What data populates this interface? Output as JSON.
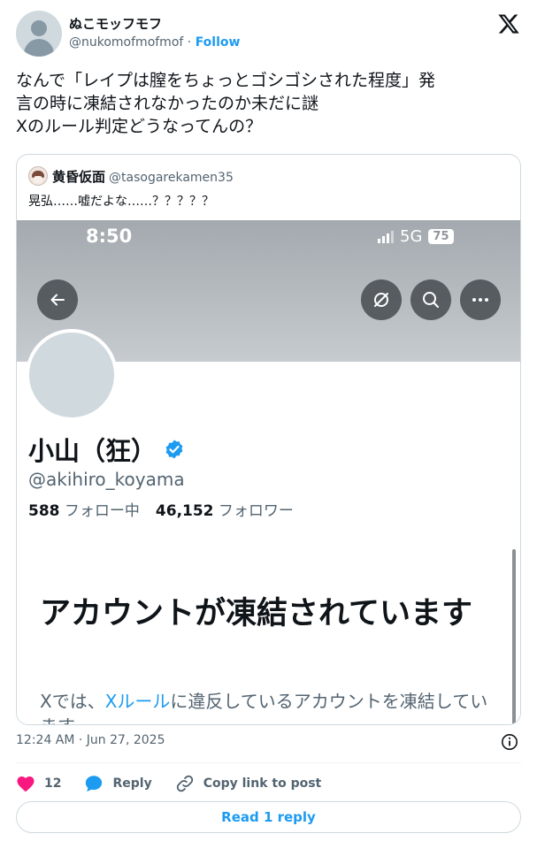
{
  "author": {
    "display_name": "ぬこモッフモフ",
    "handle": "@nukomofmofmof",
    "separator": " · ",
    "follow_label": "Follow"
  },
  "tweet": {
    "lines": [
      "なんで「レイプは膣をちょっとゴシゴシされた程度」発",
      "言の時に凍結されなかったのか未だに謎",
      "Xのルール判定どうなってんの？"
    ]
  },
  "quote": {
    "display_name": "黄昏仮面",
    "handle": "@tasogarekamen35",
    "text": "晃弘……嘘だよな……？？？？？",
    "screenshot": {
      "status_time": "8:50",
      "network": "5G",
      "battery": "75",
      "profile_name": "小山（狂）",
      "profile_handle": "@akihiro_koyama",
      "following_count": "588",
      "following_label": " フォロー中",
      "followers_count": "46,152",
      "followers_label": " フォロワー",
      "suspended_title": "アカウントが凍結されています",
      "suspended_body_prefix": "Xでは、",
      "suspended_body_link": "Xルール",
      "suspended_body_suffix": "に違反しているアカウントを凍結しています。",
      "icons": [
        "back-arrow-icon",
        "grok-icon",
        "search-icon",
        "more-icon",
        "verified-badge-icon"
      ]
    }
  },
  "footer": {
    "timestamp": "12:24 AM · Jun 27, 2025",
    "like_count": "12",
    "reply_label": "Reply",
    "copy_link_label": "Copy link to post",
    "read_replies_label": "Read 1 reply"
  },
  "colors": {
    "accent": "#1d9bf0",
    "like": "#f91880",
    "text": "#0f1419",
    "muted": "#536471",
    "border": "#cfd9de"
  }
}
